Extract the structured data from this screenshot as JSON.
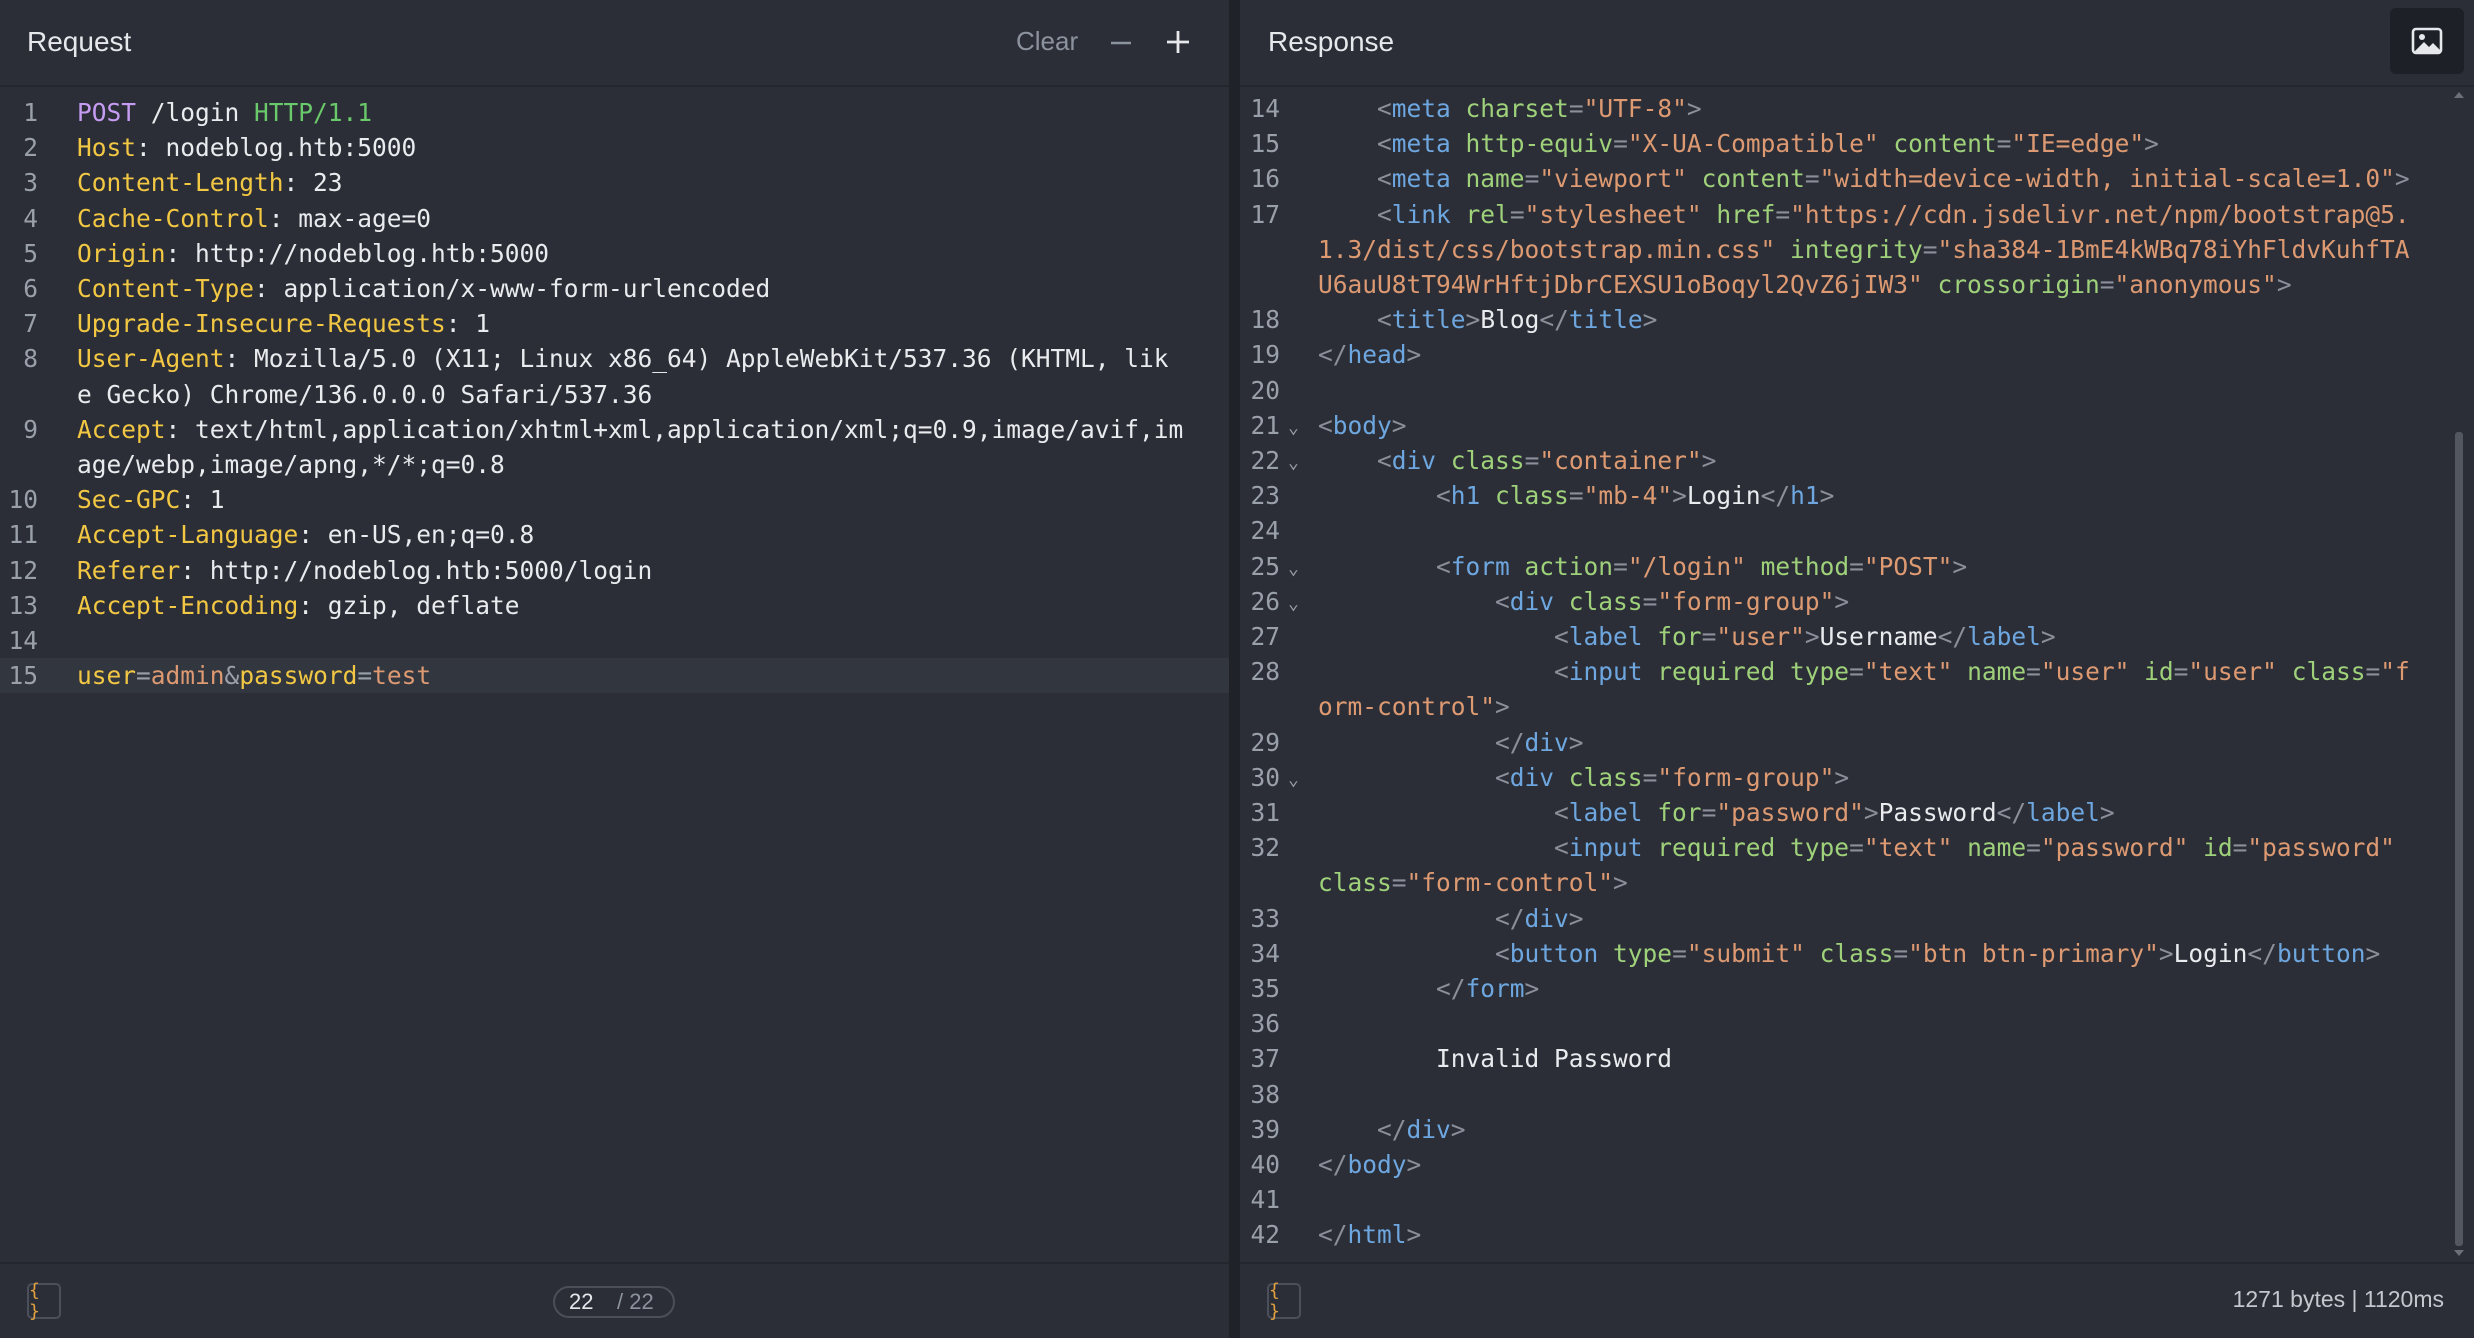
{
  "request": {
    "title": "Request",
    "clear_label": "Clear",
    "lines": [
      {
        "n": "1",
        "parts": [
          [
            "purple",
            "POST"
          ],
          [
            "txt",
            " /login "
          ],
          [
            "green",
            "HTTP/1.1"
          ]
        ]
      },
      {
        "n": "2",
        "parts": [
          [
            "yellow",
            "Host"
          ],
          [
            "txt",
            ": nodeblog.htb:5000"
          ]
        ]
      },
      {
        "n": "3",
        "parts": [
          [
            "yellow",
            "Content-Length"
          ],
          [
            "txt",
            ": 23"
          ]
        ]
      },
      {
        "n": "4",
        "parts": [
          [
            "yellow",
            "Cache-Control"
          ],
          [
            "txt",
            ": max-age=0"
          ]
        ]
      },
      {
        "n": "5",
        "parts": [
          [
            "yellow",
            "Origin"
          ],
          [
            "txt",
            ": http://nodeblog.htb:5000"
          ]
        ]
      },
      {
        "n": "6",
        "parts": [
          [
            "yellow",
            "Content-Type"
          ],
          [
            "txt",
            ": application/x-www-form-urlencoded"
          ]
        ]
      },
      {
        "n": "7",
        "parts": [
          [
            "yellow",
            "Upgrade-Insecure-Requests"
          ],
          [
            "txt",
            ": 1"
          ]
        ]
      },
      {
        "n": "8",
        "parts": [
          [
            "yellow",
            "User-Agent"
          ],
          [
            "txt",
            ": Mozilla/5.0 (X11; Linux x86_64) AppleWebKit/537.36 (KHTML, lik"
          ]
        ]
      },
      {
        "n": "",
        "parts": [
          [
            "txt",
            "e Gecko) Chrome/136.0.0.0 Safari/537.36"
          ]
        ]
      },
      {
        "n": "9",
        "parts": [
          [
            "yellow",
            "Accept"
          ],
          [
            "txt",
            ": text/html,application/xhtml+xml,application/xml;q=0.9,image/avif,im"
          ]
        ]
      },
      {
        "n": "",
        "parts": [
          [
            "txt",
            "age/webp,image/apng,*/*;q=0.8"
          ]
        ]
      },
      {
        "n": "10",
        "parts": [
          [
            "yellow",
            "Sec-GPC"
          ],
          [
            "txt",
            ": 1"
          ]
        ]
      },
      {
        "n": "11",
        "parts": [
          [
            "yellow",
            "Accept-Language"
          ],
          [
            "txt",
            ": en-US,en;q=0.8"
          ]
        ]
      },
      {
        "n": "12",
        "parts": [
          [
            "yellow",
            "Referer"
          ],
          [
            "txt",
            ": http://nodeblog.htb:5000/login"
          ]
        ]
      },
      {
        "n": "13",
        "parts": [
          [
            "yellow",
            "Accept-Encoding"
          ],
          [
            "txt",
            ": gzip, deflate"
          ]
        ]
      },
      {
        "n": "14",
        "parts": []
      },
      {
        "n": "15",
        "active": true,
        "parts": [
          [
            "yellow",
            "user"
          ],
          [
            "gray",
            "="
          ],
          [
            "orange",
            "admin"
          ],
          [
            "gray",
            "&"
          ],
          [
            "yellow",
            "password"
          ],
          [
            "gray",
            "="
          ],
          [
            "orange",
            "test"
          ]
        ]
      }
    ],
    "page_current": "22",
    "page_total": "/ 22",
    "format_label": "{ }"
  },
  "response": {
    "title": "Response",
    "lines": [
      {
        "n": "14",
        "parts": [
          [
            "txt",
            "    "
          ],
          [
            "brk",
            "<"
          ],
          [
            "tag",
            "meta"
          ],
          [
            "attr",
            " charset"
          ],
          [
            "brk",
            "="
          ],
          [
            "str",
            "\"UTF-8\""
          ],
          [
            "brk",
            ">"
          ]
        ]
      },
      {
        "n": "15",
        "parts": [
          [
            "txt",
            "    "
          ],
          [
            "brk",
            "<"
          ],
          [
            "tag",
            "meta"
          ],
          [
            "attr",
            " http-equiv"
          ],
          [
            "brk",
            "="
          ],
          [
            "str",
            "\"X-UA-Compatible\""
          ],
          [
            "attr",
            " content"
          ],
          [
            "brk",
            "="
          ],
          [
            "str",
            "\"IE=edge\""
          ],
          [
            "brk",
            ">"
          ]
        ]
      },
      {
        "n": "16",
        "parts": [
          [
            "txt",
            "    "
          ],
          [
            "brk",
            "<"
          ],
          [
            "tag",
            "meta"
          ],
          [
            "attr",
            " name"
          ],
          [
            "brk",
            "="
          ],
          [
            "str",
            "\"viewport\""
          ],
          [
            "attr",
            " content"
          ],
          [
            "brk",
            "="
          ],
          [
            "str",
            "\"width=device-width, initial-scale=1.0\""
          ],
          [
            "brk",
            ">"
          ]
        ]
      },
      {
        "n": "17",
        "parts": [
          [
            "txt",
            "    "
          ],
          [
            "brk",
            "<"
          ],
          [
            "tag",
            "link"
          ],
          [
            "attr",
            " rel"
          ],
          [
            "brk",
            "="
          ],
          [
            "str",
            "\"stylesheet\""
          ],
          [
            "attr",
            " href"
          ],
          [
            "brk",
            "="
          ],
          [
            "str",
            "\"https://cdn.jsdelivr.net/npm/bootstrap@5."
          ]
        ]
      },
      {
        "n": "",
        "parts": [
          [
            "str",
            "1.3/dist/css/bootstrap.min.css\""
          ],
          [
            "attr",
            " integrity"
          ],
          [
            "brk",
            "="
          ],
          [
            "str",
            "\"sha384-1BmE4kWBq78iYhFldvKuhfTA"
          ]
        ]
      },
      {
        "n": "",
        "parts": [
          [
            "str",
            "U6auU8tT94WrHftjDbrCEXSU1oBoqyl2QvZ6jIW3\""
          ],
          [
            "attr",
            " crossorigin"
          ],
          [
            "brk",
            "="
          ],
          [
            "str",
            "\"anonymous\""
          ],
          [
            "brk",
            ">"
          ]
        ]
      },
      {
        "n": "18",
        "parts": [
          [
            "txt",
            "    "
          ],
          [
            "brk",
            "<"
          ],
          [
            "tag",
            "title"
          ],
          [
            "brk",
            ">"
          ],
          [
            "txt",
            "Blog"
          ],
          [
            "brk",
            "</"
          ],
          [
            "tag",
            "title"
          ],
          [
            "brk",
            ">"
          ]
        ]
      },
      {
        "n": "19",
        "parts": [
          [
            "brk",
            "</"
          ],
          [
            "tag",
            "head"
          ],
          [
            "brk",
            ">"
          ]
        ]
      },
      {
        "n": "20",
        "parts": []
      },
      {
        "n": "21",
        "fold": true,
        "parts": [
          [
            "brk",
            "<"
          ],
          [
            "tag",
            "body"
          ],
          [
            "brk",
            ">"
          ]
        ]
      },
      {
        "n": "22",
        "fold": true,
        "parts": [
          [
            "txt",
            "    "
          ],
          [
            "brk",
            "<"
          ],
          [
            "tag",
            "div"
          ],
          [
            "attr",
            " class"
          ],
          [
            "brk",
            "="
          ],
          [
            "str",
            "\"container\""
          ],
          [
            "brk",
            ">"
          ]
        ]
      },
      {
        "n": "23",
        "parts": [
          [
            "txt",
            "        "
          ],
          [
            "brk",
            "<"
          ],
          [
            "tag",
            "h1"
          ],
          [
            "attr",
            " class"
          ],
          [
            "brk",
            "="
          ],
          [
            "str",
            "\"mb-4\""
          ],
          [
            "brk",
            ">"
          ],
          [
            "txt",
            "Login"
          ],
          [
            "brk",
            "</"
          ],
          [
            "tag",
            "h1"
          ],
          [
            "brk",
            ">"
          ]
        ]
      },
      {
        "n": "24",
        "parts": []
      },
      {
        "n": "25",
        "fold": true,
        "parts": [
          [
            "txt",
            "        "
          ],
          [
            "brk",
            "<"
          ],
          [
            "tag",
            "form"
          ],
          [
            "attr",
            " action"
          ],
          [
            "brk",
            "="
          ],
          [
            "str",
            "\"/login\""
          ],
          [
            "attr",
            " method"
          ],
          [
            "brk",
            "="
          ],
          [
            "str",
            "\"POST\""
          ],
          [
            "brk",
            ">"
          ]
        ]
      },
      {
        "n": "26",
        "fold": true,
        "parts": [
          [
            "txt",
            "            "
          ],
          [
            "brk",
            "<"
          ],
          [
            "tag",
            "div"
          ],
          [
            "attr",
            " class"
          ],
          [
            "brk",
            "="
          ],
          [
            "str",
            "\"form-group\""
          ],
          [
            "brk",
            ">"
          ]
        ]
      },
      {
        "n": "27",
        "parts": [
          [
            "txt",
            "                "
          ],
          [
            "brk",
            "<"
          ],
          [
            "tag",
            "label"
          ],
          [
            "attr",
            " for"
          ],
          [
            "brk",
            "="
          ],
          [
            "str",
            "\"user\""
          ],
          [
            "brk",
            ">"
          ],
          [
            "txt",
            "Username"
          ],
          [
            "brk",
            "</"
          ],
          [
            "tag",
            "label"
          ],
          [
            "brk",
            ">"
          ]
        ]
      },
      {
        "n": "28",
        "parts": [
          [
            "txt",
            "                "
          ],
          [
            "brk",
            "<"
          ],
          [
            "tag",
            "input"
          ],
          [
            "attr",
            " required type"
          ],
          [
            "brk",
            "="
          ],
          [
            "str",
            "\"text\""
          ],
          [
            "attr",
            " name"
          ],
          [
            "brk",
            "="
          ],
          [
            "str",
            "\"user\""
          ],
          [
            "attr",
            " id"
          ],
          [
            "brk",
            "="
          ],
          [
            "str",
            "\"user\""
          ],
          [
            "attr",
            " class"
          ],
          [
            "brk",
            "="
          ],
          [
            "str",
            "\"f"
          ]
        ]
      },
      {
        "n": "",
        "parts": [
          [
            "str",
            "orm-control\""
          ],
          [
            "brk",
            ">"
          ]
        ]
      },
      {
        "n": "29",
        "parts": [
          [
            "txt",
            "            "
          ],
          [
            "brk",
            "</"
          ],
          [
            "tag",
            "div"
          ],
          [
            "brk",
            ">"
          ]
        ]
      },
      {
        "n": "30",
        "fold": true,
        "parts": [
          [
            "txt",
            "            "
          ],
          [
            "brk",
            "<"
          ],
          [
            "tag",
            "div"
          ],
          [
            "attr",
            " class"
          ],
          [
            "brk",
            "="
          ],
          [
            "str",
            "\"form-group\""
          ],
          [
            "brk",
            ">"
          ]
        ]
      },
      {
        "n": "31",
        "parts": [
          [
            "txt",
            "                "
          ],
          [
            "brk",
            "<"
          ],
          [
            "tag",
            "label"
          ],
          [
            "attr",
            " for"
          ],
          [
            "brk",
            "="
          ],
          [
            "str",
            "\"password\""
          ],
          [
            "brk",
            ">"
          ],
          [
            "txt",
            "Password"
          ],
          [
            "brk",
            "</"
          ],
          [
            "tag",
            "label"
          ],
          [
            "brk",
            ">"
          ]
        ]
      },
      {
        "n": "32",
        "parts": [
          [
            "txt",
            "                "
          ],
          [
            "brk",
            "<"
          ],
          [
            "tag",
            "input"
          ],
          [
            "attr",
            " required type"
          ],
          [
            "brk",
            "="
          ],
          [
            "str",
            "\"text\""
          ],
          [
            "attr",
            " name"
          ],
          [
            "brk",
            "="
          ],
          [
            "str",
            "\"password\""
          ],
          [
            "attr",
            " id"
          ],
          [
            "brk",
            "="
          ],
          [
            "str",
            "\"password\""
          ]
        ]
      },
      {
        "n": "",
        "parts": [
          [
            "attr",
            "class"
          ],
          [
            "brk",
            "="
          ],
          [
            "str",
            "\"form-control\""
          ],
          [
            "brk",
            ">"
          ]
        ]
      },
      {
        "n": "33",
        "parts": [
          [
            "txt",
            "            "
          ],
          [
            "brk",
            "</"
          ],
          [
            "tag",
            "div"
          ],
          [
            "brk",
            ">"
          ]
        ]
      },
      {
        "n": "34",
        "parts": [
          [
            "txt",
            "            "
          ],
          [
            "brk",
            "<"
          ],
          [
            "tag",
            "button"
          ],
          [
            "attr",
            " type"
          ],
          [
            "brk",
            "="
          ],
          [
            "str",
            "\"submit\""
          ],
          [
            "attr",
            " class"
          ],
          [
            "brk",
            "="
          ],
          [
            "str",
            "\"btn btn-primary\""
          ],
          [
            "brk",
            ">"
          ],
          [
            "txt",
            "Login"
          ],
          [
            "brk",
            "</"
          ],
          [
            "tag",
            "button"
          ],
          [
            "brk",
            ">"
          ]
        ]
      },
      {
        "n": "35",
        "parts": [
          [
            "txt",
            "        "
          ],
          [
            "brk",
            "</"
          ],
          [
            "tag",
            "form"
          ],
          [
            "brk",
            ">"
          ]
        ]
      },
      {
        "n": "36",
        "parts": []
      },
      {
        "n": "37",
        "parts": [
          [
            "txt",
            "        Invalid Password"
          ]
        ]
      },
      {
        "n": "38",
        "parts": []
      },
      {
        "n": "39",
        "parts": [
          [
            "txt",
            "    "
          ],
          [
            "brk",
            "</"
          ],
          [
            "tag",
            "div"
          ],
          [
            "brk",
            ">"
          ]
        ]
      },
      {
        "n": "40",
        "parts": [
          [
            "brk",
            "</"
          ],
          [
            "tag",
            "body"
          ],
          [
            "brk",
            ">"
          ]
        ]
      },
      {
        "n": "41",
        "parts": []
      },
      {
        "n": "42",
        "parts": [
          [
            "brk",
            "</"
          ],
          [
            "tag",
            "html"
          ],
          [
            "brk",
            ">"
          ]
        ]
      }
    ],
    "format_label": "{ }",
    "stats": "1271 bytes  |  1120ms"
  },
  "icons": {
    "minus": "minus-icon",
    "plus": "plus-icon",
    "image": "image-icon",
    "fold": "chevron-down-icon"
  },
  "colors": {
    "background": "#2b2e36",
    "header_keyword": "#f2c743",
    "method": "#c69cf2",
    "protocol": "#6ac96a",
    "tag": "#6ea7e0",
    "string": "#dd9a72",
    "attribute": "#9fd17b"
  }
}
